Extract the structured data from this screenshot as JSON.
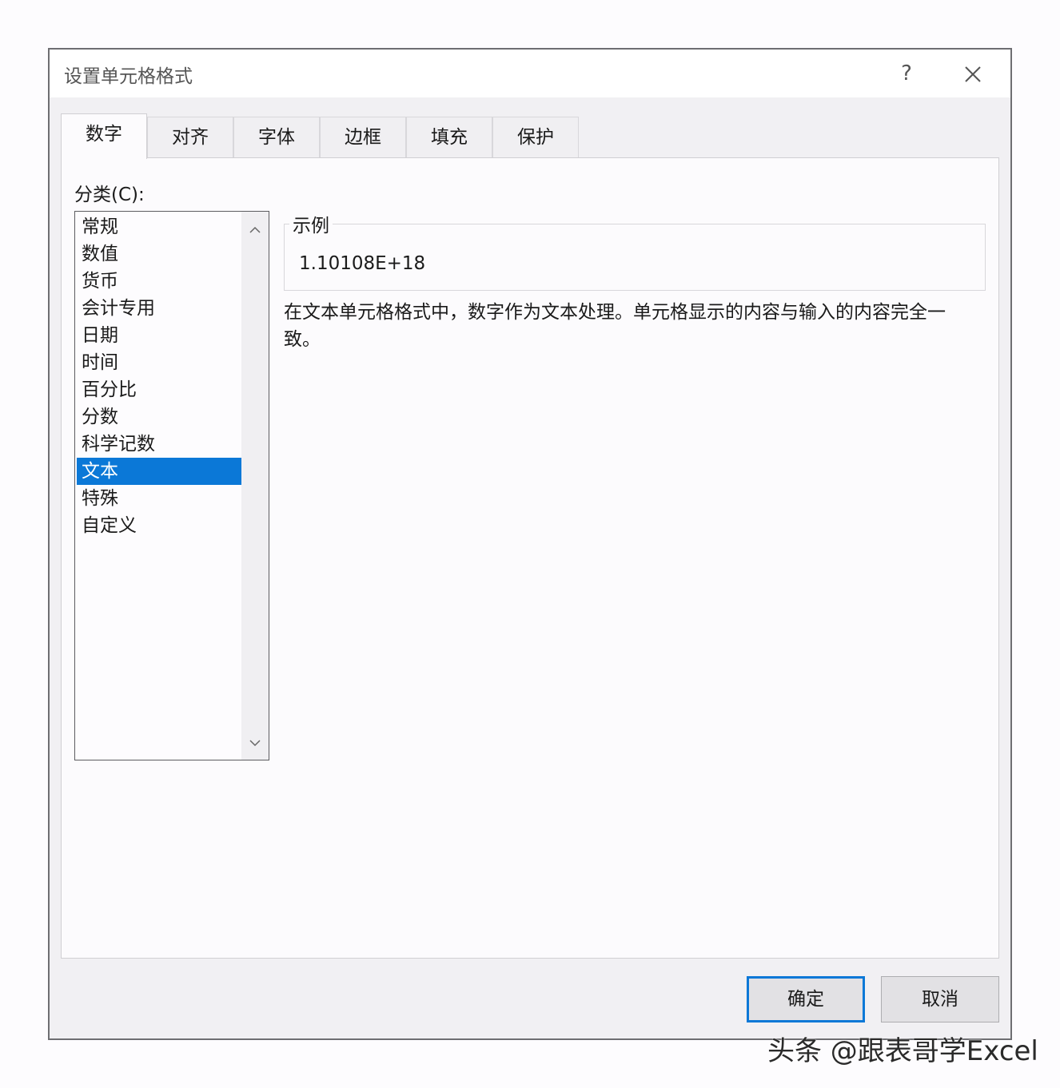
{
  "dialog": {
    "title": "设置单元格格式",
    "help_symbol": "?"
  },
  "tabs": [
    {
      "label": "数字"
    },
    {
      "label": "对齐"
    },
    {
      "label": "字体"
    },
    {
      "label": "边框"
    },
    {
      "label": "填充"
    },
    {
      "label": "保护"
    }
  ],
  "category": {
    "label": "分类(C):",
    "items": [
      "常规",
      "数值",
      "货币",
      "会计专用",
      "日期",
      "时间",
      "百分比",
      "分数",
      "科学记数",
      "文本",
      "特殊",
      "自定义"
    ],
    "selected": "文本"
  },
  "sample": {
    "legend": "示例",
    "value": "1.10108E+18"
  },
  "description": "在文本单元格格式中，数字作为文本处理。单元格显示的内容与输入的内容完全一致。",
  "buttons": {
    "ok": "确定",
    "cancel": "取消"
  },
  "watermark": "头条 @跟表哥学Excel",
  "colors": {
    "selection": "#0b78d7",
    "focus_border": "#0b78d7"
  }
}
